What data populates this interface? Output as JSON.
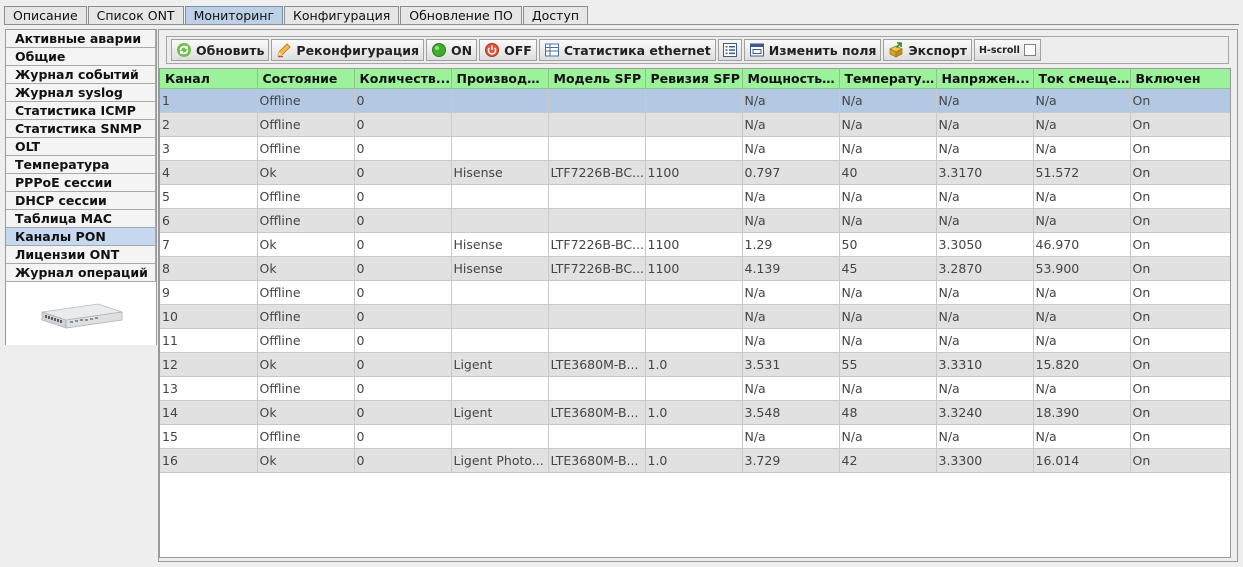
{
  "tabs": [
    {
      "label": "Описание",
      "active": false
    },
    {
      "label": "Список ONT",
      "active": false
    },
    {
      "label": "Мониторинг",
      "active": true
    },
    {
      "label": "Конфигурация",
      "active": false
    },
    {
      "label": "Обновление ПО",
      "active": false
    },
    {
      "label": "Доступ",
      "active": false
    }
  ],
  "nav": {
    "items": [
      {
        "label": "Активные аварии",
        "active": false
      },
      {
        "label": "Общие",
        "active": false
      },
      {
        "label": "Журнал событий",
        "active": false
      },
      {
        "label": "Журнал syslog",
        "active": false
      },
      {
        "label": "Статистика ICMP",
        "active": false
      },
      {
        "label": "Статистика SNMP",
        "active": false
      },
      {
        "label": "OLT",
        "active": false
      },
      {
        "label": "Температура",
        "active": false
      },
      {
        "label": "PPPoE сессии",
        "active": false
      },
      {
        "label": "DHCP сессии",
        "active": false
      },
      {
        "label": "Таблица MAC",
        "active": false
      },
      {
        "label": "Каналы PON",
        "active": true
      },
      {
        "label": "Лицензии ONT",
        "active": false
      },
      {
        "label": "Журнал операций",
        "active": false
      }
    ]
  },
  "toolbar": {
    "refresh": "Обновить",
    "reconfig": "Реконфигурация",
    "on": "ON",
    "off": "OFF",
    "eth_stats": "Статистика ethernet",
    "edit_fields": "Изменить поля",
    "export": "Экспорт",
    "hscroll": "H-scroll",
    "hscroll_checked": false
  },
  "table": {
    "columns": [
      "Канал",
      "Состояние",
      "Количеств...",
      "Производи...",
      "Модель SFP",
      "Ревизия SFP",
      "Мощность ...",
      "Температу...",
      "Напряжен...",
      "Ток смеще...",
      "Включен"
    ],
    "rows": [
      [
        "1",
        "Offline",
        "0",
        "",
        "",
        "",
        "N/a",
        "N/a",
        "N/a",
        "N/a",
        "On"
      ],
      [
        "2",
        "Offline",
        "0",
        "",
        "",
        "",
        "N/a",
        "N/a",
        "N/a",
        "N/a",
        "On"
      ],
      [
        "3",
        "Offline",
        "0",
        "",
        "",
        "",
        "N/a",
        "N/a",
        "N/a",
        "N/a",
        "On"
      ],
      [
        "4",
        "Ok",
        "0",
        "Hisense",
        "LTF7226B-BC...",
        "1100",
        "0.797",
        "40",
        "3.3170",
        "51.572",
        "On"
      ],
      [
        "5",
        "Offline",
        "0",
        "",
        "",
        "",
        "N/a",
        "N/a",
        "N/a",
        "N/a",
        "On"
      ],
      [
        "6",
        "Offline",
        "0",
        "",
        "",
        "",
        "N/a",
        "N/a",
        "N/a",
        "N/a",
        "On"
      ],
      [
        "7",
        "Ok",
        "0",
        "Hisense",
        "LTF7226B-BC...",
        "1100",
        "1.29",
        "50",
        "3.3050",
        "46.970",
        "On"
      ],
      [
        "8",
        "Ok",
        "0",
        "Hisense",
        "LTF7226B-BC...",
        "1100",
        "4.139",
        "45",
        "3.2870",
        "53.900",
        "On"
      ],
      [
        "9",
        "Offline",
        "0",
        "",
        "",
        "",
        "N/a",
        "N/a",
        "N/a",
        "N/a",
        "On"
      ],
      [
        "10",
        "Offline",
        "0",
        "",
        "",
        "",
        "N/a",
        "N/a",
        "N/a",
        "N/a",
        "On"
      ],
      [
        "11",
        "Offline",
        "0",
        "",
        "",
        "",
        "N/a",
        "N/a",
        "N/a",
        "N/a",
        "On"
      ],
      [
        "12",
        "Ok",
        "0",
        "Ligent",
        "LTE3680M-B...",
        "1.0",
        "3.531",
        "55",
        "3.3310",
        "15.820",
        "On"
      ],
      [
        "13",
        "Offline",
        "0",
        "",
        "",
        "",
        "N/a",
        "N/a",
        "N/a",
        "N/a",
        "On"
      ],
      [
        "14",
        "Ok",
        "0",
        "Ligent",
        "LTE3680M-B...",
        "1.0",
        "3.548",
        "48",
        "3.3240",
        "18.390",
        "On"
      ],
      [
        "15",
        "Offline",
        "0",
        "",
        "",
        "",
        "N/a",
        "N/a",
        "N/a",
        "N/a",
        "On"
      ],
      [
        "16",
        "Ok",
        "0",
        "Ligent Photo...",
        "LTE3680M-B...",
        "1.0",
        "3.729",
        "42",
        "3.3300",
        "16.014",
        "On"
      ]
    ],
    "selected_row": 0
  },
  "colors": {
    "header_bg": "#9bf29b",
    "selected_row": "#b3c9e3",
    "alt_row": "#e1e1e1",
    "active_tab": "#bcd0e8"
  },
  "icons": {
    "refresh": "refresh-icon",
    "reconfig": "pencil-icon",
    "on": "green-dot-icon",
    "off": "red-power-icon",
    "eth_stats": "table-icon",
    "list": "list-icon",
    "edit_fields": "window-icon",
    "export": "export-icon",
    "device": "olt-device-image"
  }
}
